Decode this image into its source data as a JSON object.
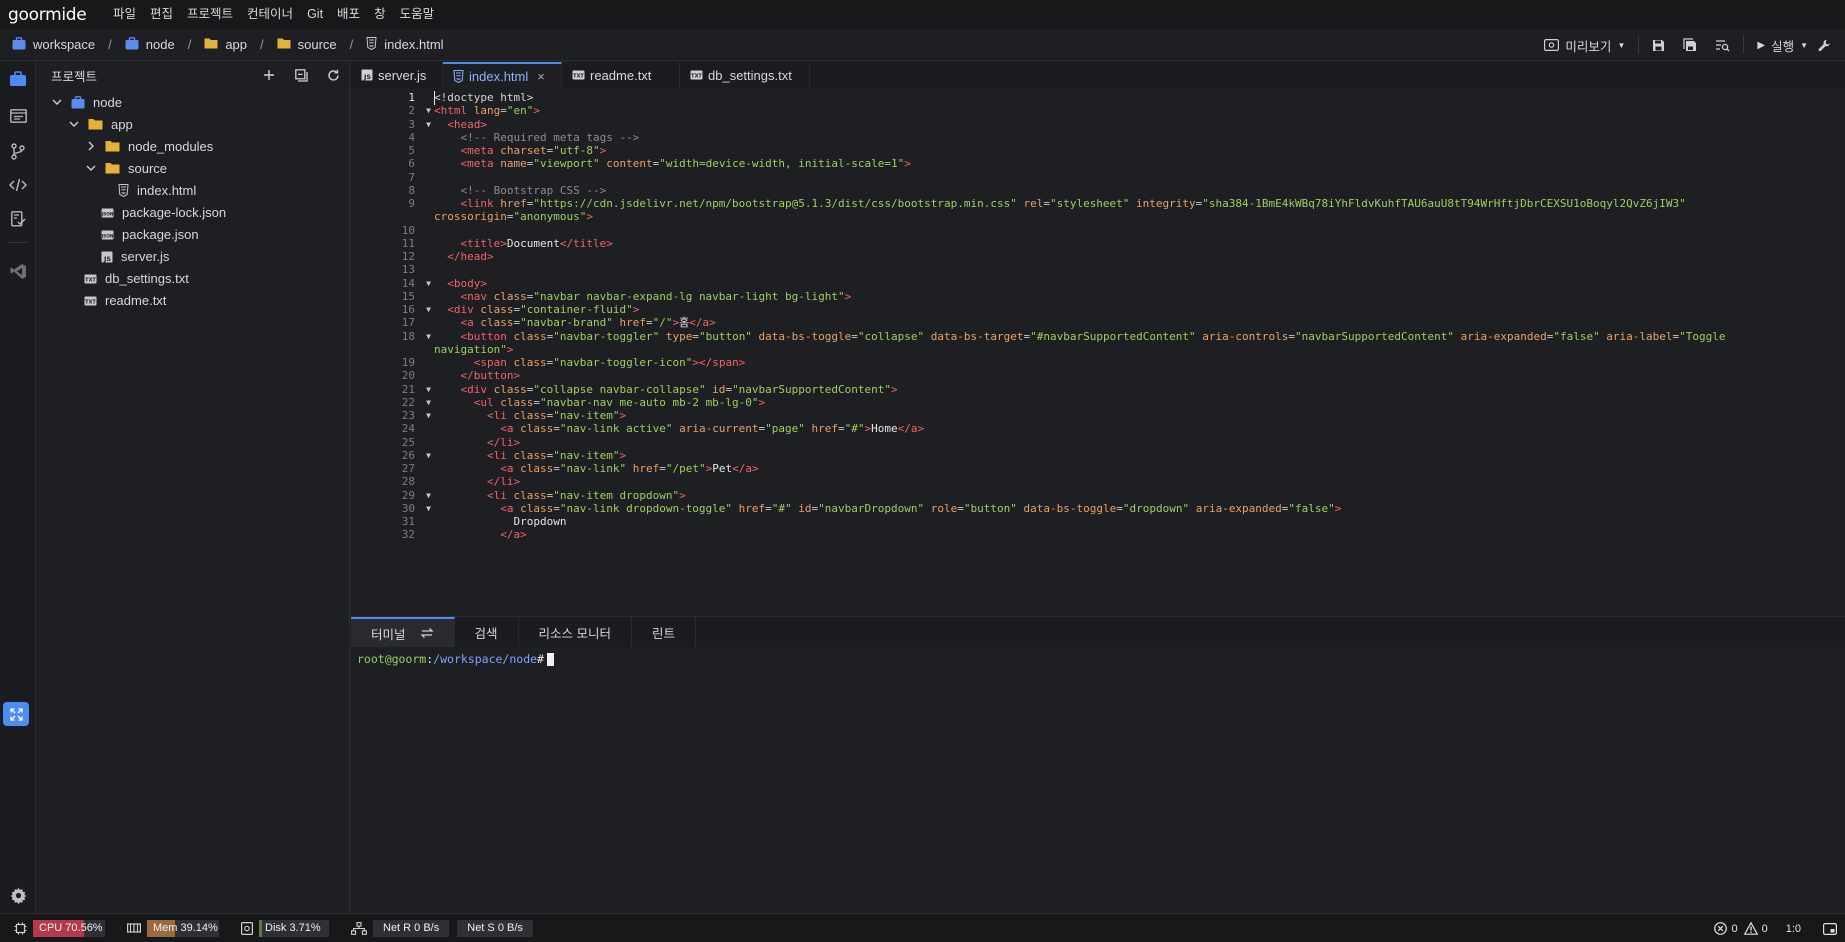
{
  "app": {
    "logo": "goormide",
    "menu": [
      "파일",
      "편집",
      "프로젝트",
      "컨테이너",
      "Git",
      "배포",
      "창",
      "도움말"
    ]
  },
  "breadcrumb": [
    "workspace",
    "node",
    "app",
    "source",
    "index.html"
  ],
  "toolbar": {
    "preview_label": "미리보기",
    "run_label": "실행"
  },
  "explorer": {
    "title": "프로젝트",
    "tree": [
      {
        "label": "node",
        "type": "folder-root",
        "expanded": true,
        "depth": 0
      },
      {
        "label": "app",
        "type": "folder",
        "expanded": true,
        "depth": 1
      },
      {
        "label": "node_modules",
        "type": "folder",
        "expanded": false,
        "depth": 2
      },
      {
        "label": "source",
        "type": "folder",
        "expanded": true,
        "depth": 2
      },
      {
        "label": "index.html",
        "type": "html",
        "depth": 3
      },
      {
        "label": "package-lock.json",
        "type": "json",
        "depth": 2
      },
      {
        "label": "package.json",
        "type": "json",
        "depth": 2
      },
      {
        "label": "server.js",
        "type": "js",
        "depth": 2
      },
      {
        "label": "db_settings.txt",
        "type": "txt",
        "depth": 1
      },
      {
        "label": "readme.txt",
        "type": "txt",
        "depth": 1
      }
    ]
  },
  "tabs": [
    {
      "label": "server.js",
      "type": "js",
      "active": false
    },
    {
      "label": "index.html",
      "type": "html",
      "active": true,
      "close": "×"
    },
    {
      "label": "readme.txt",
      "type": "txt",
      "active": false
    },
    {
      "label": "db_settings.txt",
      "type": "txt",
      "active": false
    }
  ],
  "editor": {
    "current_line": "1",
    "rows": [
      {
        "n": "1",
        "fold": false,
        "t": [
          [
            "",
            "<!doctype html>"
          ]
        ]
      },
      {
        "n": "2",
        "fold": true,
        "t": [
          [
            "tag",
            "<html"
          ],
          [
            "attr",
            " lang"
          ],
          [
            "pun",
            "="
          ],
          [
            "str",
            "\"en\""
          ],
          [
            "tag",
            ">"
          ]
        ]
      },
      {
        "n": "3",
        "fold": true,
        "t": [
          [
            "",
            "  "
          ],
          [
            "tag",
            "<head>"
          ]
        ]
      },
      {
        "n": "4",
        "fold": false,
        "t": [
          [
            "",
            "    "
          ],
          [
            "com",
            "<!-- Required meta tags -->"
          ]
        ]
      },
      {
        "n": "5",
        "fold": false,
        "t": [
          [
            "",
            "    "
          ],
          [
            "tag",
            "<meta"
          ],
          [
            "attr",
            " charset"
          ],
          [
            "pun",
            "="
          ],
          [
            "str",
            "\"utf-8\""
          ],
          [
            "tag",
            ">"
          ]
        ]
      },
      {
        "n": "6",
        "fold": false,
        "t": [
          [
            "",
            "    "
          ],
          [
            "tag",
            "<meta"
          ],
          [
            "attr",
            " name"
          ],
          [
            "pun",
            "="
          ],
          [
            "str",
            "\"viewport\""
          ],
          [
            "attr",
            " content"
          ],
          [
            "pun",
            "="
          ],
          [
            "str",
            "\"width=device-width, initial-scale=1\""
          ],
          [
            "tag",
            ">"
          ]
        ]
      },
      {
        "n": "7",
        "fold": false,
        "t": []
      },
      {
        "n": "8",
        "fold": false,
        "t": [
          [
            "",
            "    "
          ],
          [
            "com",
            "<!-- Bootstrap CSS -->"
          ]
        ]
      },
      {
        "n": "9",
        "fold": false,
        "t": [
          [
            "",
            "    "
          ],
          [
            "tag",
            "<link"
          ],
          [
            "attr",
            " href"
          ],
          [
            "pun",
            "="
          ],
          [
            "str",
            "\"https://cdn.jsdelivr.net/npm/bootstrap@5.1.3/dist/css/bootstrap.min.css\""
          ],
          [
            "attr",
            " rel"
          ],
          [
            "pun",
            "="
          ],
          [
            "str",
            "\"stylesheet\""
          ],
          [
            "attr",
            " integrity"
          ],
          [
            "pun",
            "="
          ],
          [
            "str",
            "\"sha384-1BmE4kWBq78iYhFldvKuhfTAU6auU8tT94WrHftjDbrCEXSU1oBoqyl2QvZ6jIW3\""
          ]
        ]
      },
      {
        "n": "",
        "fold": false,
        "wrap": true,
        "t": [
          [
            "attr",
            "crossorigin"
          ],
          [
            "pun",
            "="
          ],
          [
            "str",
            "\"anonymous\""
          ],
          [
            "tag",
            ">"
          ]
        ]
      },
      {
        "n": "10",
        "fold": false,
        "t": []
      },
      {
        "n": "11",
        "fold": false,
        "t": [
          [
            "",
            "    "
          ],
          [
            "tag",
            "<title>"
          ],
          [
            "txt",
            "Document"
          ],
          [
            "tag",
            "</title>"
          ]
        ]
      },
      {
        "n": "12",
        "fold": false,
        "t": [
          [
            "",
            "  "
          ],
          [
            "tag",
            "</head>"
          ]
        ]
      },
      {
        "n": "13",
        "fold": false,
        "t": []
      },
      {
        "n": "14",
        "fold": true,
        "t": [
          [
            "",
            "  "
          ],
          [
            "tag",
            "<body>"
          ]
        ]
      },
      {
        "n": "15",
        "fold": false,
        "t": [
          [
            "",
            "    "
          ],
          [
            "tag",
            "<nav"
          ],
          [
            "attr",
            " class"
          ],
          [
            "pun",
            "="
          ],
          [
            "str",
            "\"navbar navbar-expand-lg navbar-light bg-light\""
          ],
          [
            "tag",
            ">"
          ]
        ]
      },
      {
        "n": "16",
        "fold": true,
        "t": [
          [
            "",
            "  "
          ],
          [
            "tag",
            "<div"
          ],
          [
            "attr",
            " class"
          ],
          [
            "pun",
            "="
          ],
          [
            "str",
            "\"container-fluid\""
          ],
          [
            "tag",
            ">"
          ]
        ]
      },
      {
        "n": "17",
        "fold": false,
        "t": [
          [
            "",
            "    "
          ],
          [
            "tag",
            "<a"
          ],
          [
            "attr",
            " class"
          ],
          [
            "pun",
            "="
          ],
          [
            "str",
            "\"navbar-brand\""
          ],
          [
            "attr",
            " href"
          ],
          [
            "pun",
            "="
          ],
          [
            "str",
            "\"/\""
          ],
          [
            "tag",
            ">"
          ],
          [
            "txt",
            "홈"
          ],
          [
            "tag",
            "</a>"
          ]
        ]
      },
      {
        "n": "18",
        "fold": true,
        "t": [
          [
            "",
            "    "
          ],
          [
            "tag",
            "<button"
          ],
          [
            "attr",
            " class"
          ],
          [
            "pun",
            "="
          ],
          [
            "str",
            "\"navbar-toggler\""
          ],
          [
            "attr",
            " type"
          ],
          [
            "pun",
            "="
          ],
          [
            "str",
            "\"button\""
          ],
          [
            "attr",
            " data-bs-toggle"
          ],
          [
            "pun",
            "="
          ],
          [
            "str",
            "\"collapse\""
          ],
          [
            "attr",
            " data-bs-target"
          ],
          [
            "pun",
            "="
          ],
          [
            "str",
            "\"#navbarSupportedContent\""
          ],
          [
            "attr",
            " aria-controls"
          ],
          [
            "pun",
            "="
          ],
          [
            "str",
            "\"navbarSupportedContent\""
          ],
          [
            "attr",
            " aria-expanded"
          ],
          [
            "pun",
            "="
          ],
          [
            "str",
            "\"false\""
          ],
          [
            "attr",
            " aria-label"
          ],
          [
            "pun",
            "="
          ],
          [
            "str",
            "\"Toggle"
          ]
        ]
      },
      {
        "n": "",
        "fold": false,
        "wrap": true,
        "t": [
          [
            "str",
            "navigation\""
          ],
          [
            "tag",
            ">"
          ]
        ]
      },
      {
        "n": "19",
        "fold": false,
        "t": [
          [
            "",
            "      "
          ],
          [
            "tag",
            "<span"
          ],
          [
            "attr",
            " class"
          ],
          [
            "pun",
            "="
          ],
          [
            "str",
            "\"navbar-toggler-icon\""
          ],
          [
            "tag",
            "></span>"
          ]
        ]
      },
      {
        "n": "20",
        "fold": false,
        "t": [
          [
            "",
            "    "
          ],
          [
            "tag",
            "</button>"
          ]
        ]
      },
      {
        "n": "21",
        "fold": true,
        "t": [
          [
            "",
            "    "
          ],
          [
            "tag",
            "<div"
          ],
          [
            "attr",
            " class"
          ],
          [
            "pun",
            "="
          ],
          [
            "str",
            "\"collapse navbar-collapse\""
          ],
          [
            "attr",
            " id"
          ],
          [
            "pun",
            "="
          ],
          [
            "str",
            "\"navbarSupportedContent\""
          ],
          [
            "tag",
            ">"
          ]
        ]
      },
      {
        "n": "22",
        "fold": true,
        "t": [
          [
            "",
            "      "
          ],
          [
            "tag",
            "<ul"
          ],
          [
            "attr",
            " class"
          ],
          [
            "pun",
            "="
          ],
          [
            "str",
            "\"navbar-nav me-auto mb-2 mb-lg-0\""
          ],
          [
            "tag",
            ">"
          ]
        ]
      },
      {
        "n": "23",
        "fold": true,
        "t": [
          [
            "",
            "        "
          ],
          [
            "tag",
            "<li"
          ],
          [
            "attr",
            " class"
          ],
          [
            "pun",
            "="
          ],
          [
            "str",
            "\"nav-item\""
          ],
          [
            "tag",
            ">"
          ]
        ]
      },
      {
        "n": "24",
        "fold": false,
        "t": [
          [
            "",
            "          "
          ],
          [
            "tag",
            "<a"
          ],
          [
            "attr",
            " class"
          ],
          [
            "pun",
            "="
          ],
          [
            "str",
            "\"nav-link active\""
          ],
          [
            "attr",
            " aria-current"
          ],
          [
            "pun",
            "="
          ],
          [
            "str",
            "\"page\""
          ],
          [
            "attr",
            " href"
          ],
          [
            "pun",
            "="
          ],
          [
            "str",
            "\"#\""
          ],
          [
            "tag",
            ">"
          ],
          [
            "txt",
            "Home"
          ],
          [
            "tag",
            "</a>"
          ]
        ]
      },
      {
        "n": "25",
        "fold": false,
        "t": [
          [
            "",
            "        "
          ],
          [
            "tag",
            "</li>"
          ]
        ]
      },
      {
        "n": "26",
        "fold": true,
        "t": [
          [
            "",
            "        "
          ],
          [
            "tag",
            "<li"
          ],
          [
            "attr",
            " class"
          ],
          [
            "pun",
            "="
          ],
          [
            "str",
            "\"nav-item\""
          ],
          [
            "tag",
            ">"
          ]
        ]
      },
      {
        "n": "27",
        "fold": false,
        "t": [
          [
            "",
            "          "
          ],
          [
            "tag",
            "<a"
          ],
          [
            "attr",
            " class"
          ],
          [
            "pun",
            "="
          ],
          [
            "str",
            "\"nav-link\""
          ],
          [
            "attr",
            " href"
          ],
          [
            "pun",
            "="
          ],
          [
            "str",
            "\"/pet\""
          ],
          [
            "tag",
            ">"
          ],
          [
            "txt",
            "Pet"
          ],
          [
            "tag",
            "</a>"
          ]
        ]
      },
      {
        "n": "28",
        "fold": false,
        "t": [
          [
            "",
            "        "
          ],
          [
            "tag",
            "</li>"
          ]
        ]
      },
      {
        "n": "29",
        "fold": true,
        "t": [
          [
            "",
            "        "
          ],
          [
            "tag",
            "<li"
          ],
          [
            "attr",
            " class"
          ],
          [
            "pun",
            "="
          ],
          [
            "str",
            "\"nav-item dropdown\""
          ],
          [
            "tag",
            ">"
          ]
        ]
      },
      {
        "n": "30",
        "fold": true,
        "t": [
          [
            "",
            "          "
          ],
          [
            "tag",
            "<a"
          ],
          [
            "attr",
            " class"
          ],
          [
            "pun",
            "="
          ],
          [
            "str",
            "\"nav-link dropdown-toggle\""
          ],
          [
            "attr",
            " href"
          ],
          [
            "pun",
            "="
          ],
          [
            "str",
            "\"#\""
          ],
          [
            "attr",
            " id"
          ],
          [
            "pun",
            "="
          ],
          [
            "str",
            "\"navbarDropdown\""
          ],
          [
            "attr",
            " role"
          ],
          [
            "pun",
            "="
          ],
          [
            "str",
            "\"button\""
          ],
          [
            "attr",
            " data-bs-toggle"
          ],
          [
            "pun",
            "="
          ],
          [
            "str",
            "\"dropdown\""
          ],
          [
            "attr",
            " aria-expanded"
          ],
          [
            "pun",
            "="
          ],
          [
            "str",
            "\"false\""
          ],
          [
            "tag",
            ">"
          ]
        ]
      },
      {
        "n": "31",
        "fold": false,
        "t": [
          [
            "",
            "            "
          ],
          [
            "txt",
            "Dropdown"
          ]
        ]
      },
      {
        "n": "32",
        "fold": false,
        "t": [
          [
            "",
            "          "
          ],
          [
            "tag",
            "</a>"
          ]
        ]
      }
    ]
  },
  "panel": {
    "tabs": [
      "터미널",
      "검색",
      "리소스 모니터",
      "린트"
    ],
    "terminal": {
      "user": "root@goorm",
      "sep": ":",
      "path": "/workspace/node",
      "hash": "#"
    }
  },
  "status": {
    "cpu": {
      "label": "CPU 70.56%",
      "fraction": 0.7056,
      "color": "#b23a4b"
    },
    "mem": {
      "label": "Mem 39.14%",
      "fraction": 0.3914,
      "color": "#9a6a3c"
    },
    "disk": {
      "label": "Disk 3.71%",
      "fraction": 0.0371,
      "color": "#5b7a4a"
    },
    "net_r": "Net R 0 B/s",
    "net_s": "Net S 0 B/s",
    "errors": "0",
    "warnings": "0",
    "position": "1:0"
  },
  "colors": {
    "accent": "#4f8bf5",
    "folder": "#e5b13a",
    "tag": "#f2626b",
    "attr": "#e9a166",
    "string": "#9fcf5f",
    "comment": "#8a8d92"
  }
}
